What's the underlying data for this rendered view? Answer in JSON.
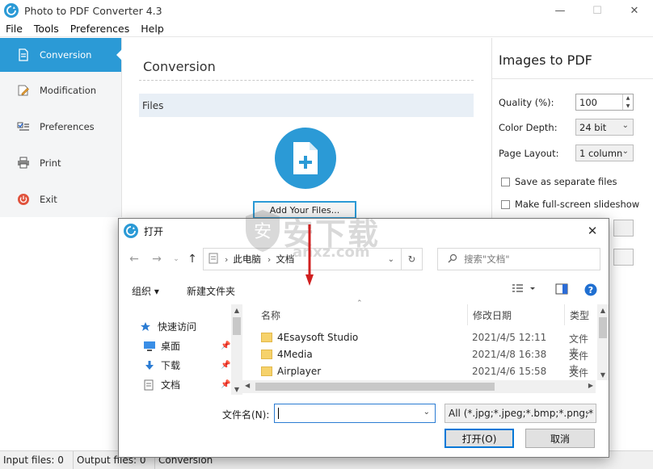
{
  "window": {
    "title": "Photo to PDF Converter 4.3",
    "minimize_glyph": "—",
    "maximize_glyph": "☐",
    "close_glyph": "✕"
  },
  "menu": [
    "File",
    "Tools",
    "Preferences",
    "Help"
  ],
  "sidebar": {
    "items": [
      {
        "label": "Conversion",
        "icon": "document-icon"
      },
      {
        "label": "Modification",
        "icon": "edit-icon"
      },
      {
        "label": "Preferences",
        "icon": "checklist-icon"
      },
      {
        "label": "Print",
        "icon": "printer-icon"
      },
      {
        "label": "Exit",
        "icon": "power-icon"
      }
    ]
  },
  "main": {
    "title": "Conversion",
    "files_header": "Files",
    "add_files_label": "Add Your Files..."
  },
  "panel": {
    "title": "Images to PDF",
    "quality_label": "Quality (%):",
    "quality_value": "100",
    "color_depth_label": "Color Depth:",
    "color_depth_value": "24 bit",
    "page_layout_label": "Page Layout:",
    "page_layout_value": "1 column",
    "save_separate_label": "Save as separate files",
    "slideshow_label": "Make full-screen slideshow"
  },
  "status": {
    "input": "Input files: 0",
    "output": "Output files: 0",
    "mode": "Conversion"
  },
  "dialog": {
    "title": "打开",
    "address": [
      "此电脑",
      "文档"
    ],
    "search_placeholder": "搜索\"文档\"",
    "organize_label": "组织 ▾",
    "new_folder_label": "新建文件夹",
    "nav": [
      {
        "label": "快速访问",
        "icon": "star-icon"
      },
      {
        "label": "桌面",
        "icon": "desktop-icon"
      },
      {
        "label": "下载",
        "icon": "download-icon"
      },
      {
        "label": "文档",
        "icon": "documents-icon"
      }
    ],
    "columns": [
      "名称",
      "修改日期",
      "类型"
    ],
    "rows": [
      {
        "name": "4Esaysoft Studio",
        "date": "2021/4/5 12:11",
        "type": "文件夹"
      },
      {
        "name": "4Media",
        "date": "2021/4/8 16:38",
        "type": "文件夹"
      },
      {
        "name": "Airplayer",
        "date": "2021/4/6 15:58",
        "type": "文件夹"
      }
    ],
    "filename_label": "文件名(N):",
    "filename_value": "",
    "filetype_value": "All (*.jpg;*.jpeg;*.bmp;*.png;*",
    "open_label": "打开(O)",
    "cancel_label": "取消"
  },
  "watermark": {
    "text": "安下载",
    "sub": "anxz.com"
  },
  "colors": {
    "accent": "#2b9ad6",
    "sidebar_bg": "#f4f5f6",
    "files_bar": "#e8eff6"
  }
}
